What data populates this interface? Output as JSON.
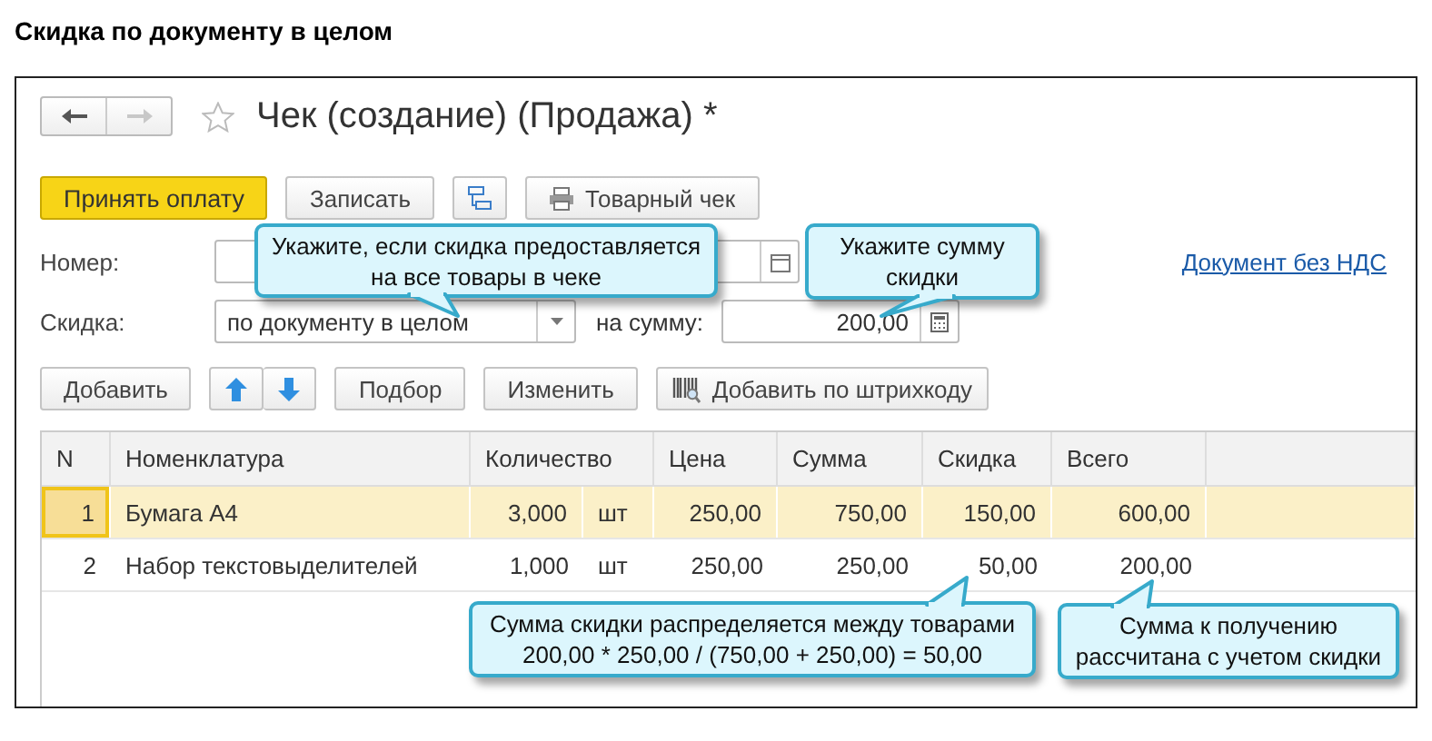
{
  "heading": "Скидка по документу в целом",
  "form": {
    "title": "Чек (создание) (Продажа) *"
  },
  "toolbar": [
    {
      "kind": "primary",
      "label": "Принять оплату"
    },
    {
      "kind": "plain",
      "label": "Записать"
    },
    {
      "kind": "structure"
    },
    {
      "kind": "print",
      "label": "Товарный чек"
    }
  ],
  "number": {
    "label": "Номер:"
  },
  "link": "Документ без НДС",
  "discount": {
    "label": "Скидка:",
    "mode": "по документу в целом",
    "amount_label": "на сумму:",
    "amount": "200,00"
  },
  "table_buttons": [
    {
      "kind": "plain",
      "label": "Добавить"
    },
    {
      "kind": "updown"
    },
    {
      "kind": "plain",
      "label": "Подбор"
    },
    {
      "kind": "plain",
      "label": "Изменить"
    },
    {
      "kind": "barcode",
      "label": "Добавить по штрихкоду"
    }
  ],
  "table": {
    "columns": [
      "N",
      "Номенклатура",
      "Количество",
      "Цена",
      "Сумма",
      "Скидка",
      "Всего"
    ],
    "rows": [
      {
        "n": "1",
        "name": "Бумага А4",
        "qty": "3,000",
        "unit": "шт",
        "price": "250,00",
        "sum": "750,00",
        "discount": "150,00",
        "total": "600,00",
        "selected": true
      },
      {
        "n": "2",
        "name": "Набор текстовыделителей",
        "qty": "1,000",
        "unit": "шт",
        "price": "250,00",
        "sum": "250,00",
        "discount": "50,00",
        "total": "200,00",
        "selected": false
      }
    ]
  },
  "callouts": [
    {
      "text": "Укажите, если скидка предоставляется\nна все товары в чеке"
    },
    {
      "text": "Укажите сумму\nскидки"
    },
    {
      "text": "Сумма скидки распределяется между товарами\n200,00 * 250,00 / (750,00 + 250,00) = 50,00"
    },
    {
      "text": "Сумма к получению\nрассчитана с учетом скидки"
    }
  ]
}
